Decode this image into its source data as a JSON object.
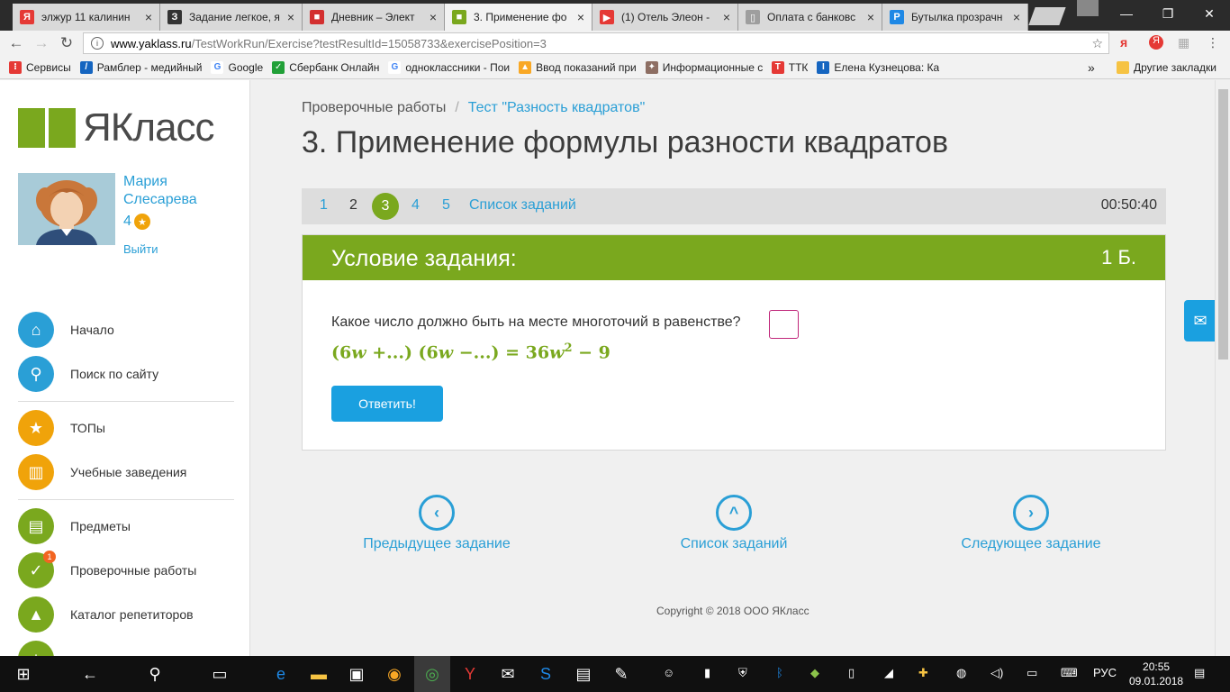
{
  "browser": {
    "tabs": [
      {
        "title": "элжур 11 калинин",
        "icon": "yandex-icon",
        "color": "#e53935",
        "glyph": "Я"
      },
      {
        "title": "Задание легкое, я",
        "icon": "znanija-icon",
        "color": "#333333",
        "glyph": "З"
      },
      {
        "title": "Дневник – Элект",
        "icon": "diary-icon",
        "color": "#d32f2f",
        "glyph": "■"
      },
      {
        "title": "3. Применение фо",
        "icon": "yaklass-icon",
        "color": "#7aa81e",
        "glyph": "■"
      },
      {
        "title": "(1) Отель Элеон -",
        "icon": "youtube-icon",
        "color": "#e53935",
        "glyph": "▶"
      },
      {
        "title": "Оплата с банковс",
        "icon": "document-icon",
        "color": "#9e9e9e",
        "glyph": "▯"
      },
      {
        "title": "Бутылка прозрачн",
        "icon": "search-icon",
        "color": "#1e88e5",
        "glyph": "P"
      }
    ],
    "url_host": "www.yaklass.ru",
    "url_path": "/TestWorkRun/Exercise?testResultId=15058733&exercisePosition=3",
    "bookmarks": [
      {
        "label": "Сервисы",
        "icon": "apps-icon",
        "color": "#e53935"
      },
      {
        "label": "Рамблер - медийный",
        "icon": "rambler-icon",
        "color": "#1565c0"
      },
      {
        "label": "Google",
        "icon": "google-icon",
        "color": "#4285f4"
      },
      {
        "label": "Сбербанк Онлайн",
        "icon": "sberbank-icon",
        "color": "#21a038"
      },
      {
        "label": "одноклассники - Пои",
        "icon": "google-icon",
        "color": "#4285f4"
      },
      {
        "label": "Ввод показаний при",
        "icon": "meter-icon",
        "color": "#f9a825"
      },
      {
        "label": "Информационные с",
        "icon": "emblem-icon",
        "color": "#8d6e63"
      },
      {
        "label": "ТТК",
        "icon": "ttk-icon",
        "color": "#e53935"
      },
      {
        "label": "Елена Кузнецова: Ка",
        "icon": "ie-icon",
        "color": "#1565c0"
      }
    ],
    "bookmarks_more": "»",
    "other_bookmarks": "Другие закладки"
  },
  "sidebar": {
    "logo_text": "ЯКласс",
    "user_name": "Мария Слесарева",
    "user_score": "4",
    "logout": "Выйти",
    "menu": [
      {
        "label": "Начало",
        "icon": "home-icon",
        "color": "#2a9fd6",
        "glyph": "⌂"
      },
      {
        "label": "Поиск по сайту",
        "icon": "search-icon",
        "color": "#2a9fd6",
        "glyph": "⚲"
      },
      {
        "label": "ТОПы",
        "icon": "star-icon",
        "color": "#f0a30a",
        "glyph": "★"
      },
      {
        "label": "Учебные заведения",
        "icon": "school-icon",
        "color": "#f0a30a",
        "glyph": "▥"
      },
      {
        "label": "Предметы",
        "icon": "book-icon",
        "color": "#7aa81e",
        "glyph": "▤"
      },
      {
        "label": "Проверочные работы",
        "icon": "check-icon",
        "color": "#7aa81e",
        "glyph": "✓",
        "badge": "1"
      },
      {
        "label": "Каталог репетиторов",
        "icon": "graduation-cap-icon",
        "color": "#7aa81e",
        "glyph": "▲"
      }
    ]
  },
  "main": {
    "breadcrumb_root": "Проверочные работы",
    "breadcrumb_sep": "/",
    "breadcrumb_current": "Тест \"Разность квадратов\"",
    "title": "3. Применение формулы разности квадратов",
    "task_nav": {
      "items": [
        "1",
        "2",
        "3",
        "4",
        "5"
      ],
      "active": "3",
      "list_label": "Список заданий",
      "timer": "00:50:40"
    },
    "task": {
      "header": "Условие задания:",
      "points": "1 Б.",
      "question": "Какое число должно быть на месте многоточий в равенстве?",
      "formula": {
        "a": "(6",
        "b": "w",
        "c": " +...) (6",
        "d": "w",
        "e": " −...) = 36",
        "f": "w",
        "exp": "2",
        "g": " − 9"
      },
      "answer_button": "Ответить!"
    },
    "bottom_nav": {
      "prev": "Предыдущее задание",
      "list": "Список заданий",
      "next": "Следующее задание"
    },
    "copyright": "Copyright © 2018 ООО ЯКласс"
  },
  "taskbar": {
    "lang": "РУС",
    "time": "20:55",
    "date": "09.01.2018"
  },
  "colors": {
    "brand_green": "#7aa81e",
    "link_blue": "#2a9fd6",
    "button_blue": "#1aa0e0"
  }
}
